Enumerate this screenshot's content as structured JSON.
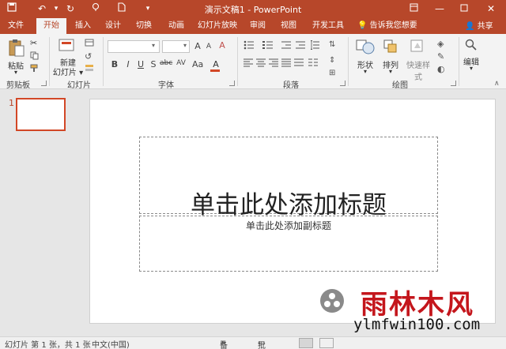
{
  "window": {
    "title": "演示文稿1 - PowerPoint"
  },
  "quick_access": [
    "save-icon",
    "undo-icon",
    "redo-icon",
    "touch-mode-icon",
    "new-file-icon",
    "customize-icon"
  ],
  "tabs": [
    {
      "label": "文件"
    },
    {
      "label": "开始",
      "active": true
    },
    {
      "label": "插入"
    },
    {
      "label": "设计"
    },
    {
      "label": "切换"
    },
    {
      "label": "动画"
    },
    {
      "label": "幻灯片放映"
    },
    {
      "label": "审阅"
    },
    {
      "label": "视图"
    },
    {
      "label": "开发工具"
    }
  ],
  "tell_me": "告诉我您想要",
  "share": "共享",
  "ribbon": {
    "clipboard": {
      "label": "剪贴板",
      "paste": "粘贴"
    },
    "slides": {
      "label": "幻灯片",
      "new_slide_1": "新建",
      "new_slide_2": "幻灯片 ▾"
    },
    "font": {
      "label": "字体"
    },
    "paragraph": {
      "label": "段落"
    },
    "drawing": {
      "label": "绘图",
      "shapes": "形状",
      "arrange": "排列",
      "quick_styles": "快速样式"
    },
    "editing": {
      "label": "编辑"
    }
  },
  "thumbnails": [
    {
      "number": "1"
    }
  ],
  "slide": {
    "title_placeholder": "单击此处添加标题",
    "subtitle_placeholder": "单击此处添加副标题"
  },
  "status": {
    "slide_info": "幻灯片 第 1 张，共 1 张",
    "language": "中文(中国)",
    "notes": "备注",
    "comments": "批注"
  },
  "watermark": {
    "brand": "雨林木风",
    "url": "ylmfwin100.com"
  },
  "colors": {
    "accent": "#b7472a",
    "watermark_red": "#c4161c"
  }
}
